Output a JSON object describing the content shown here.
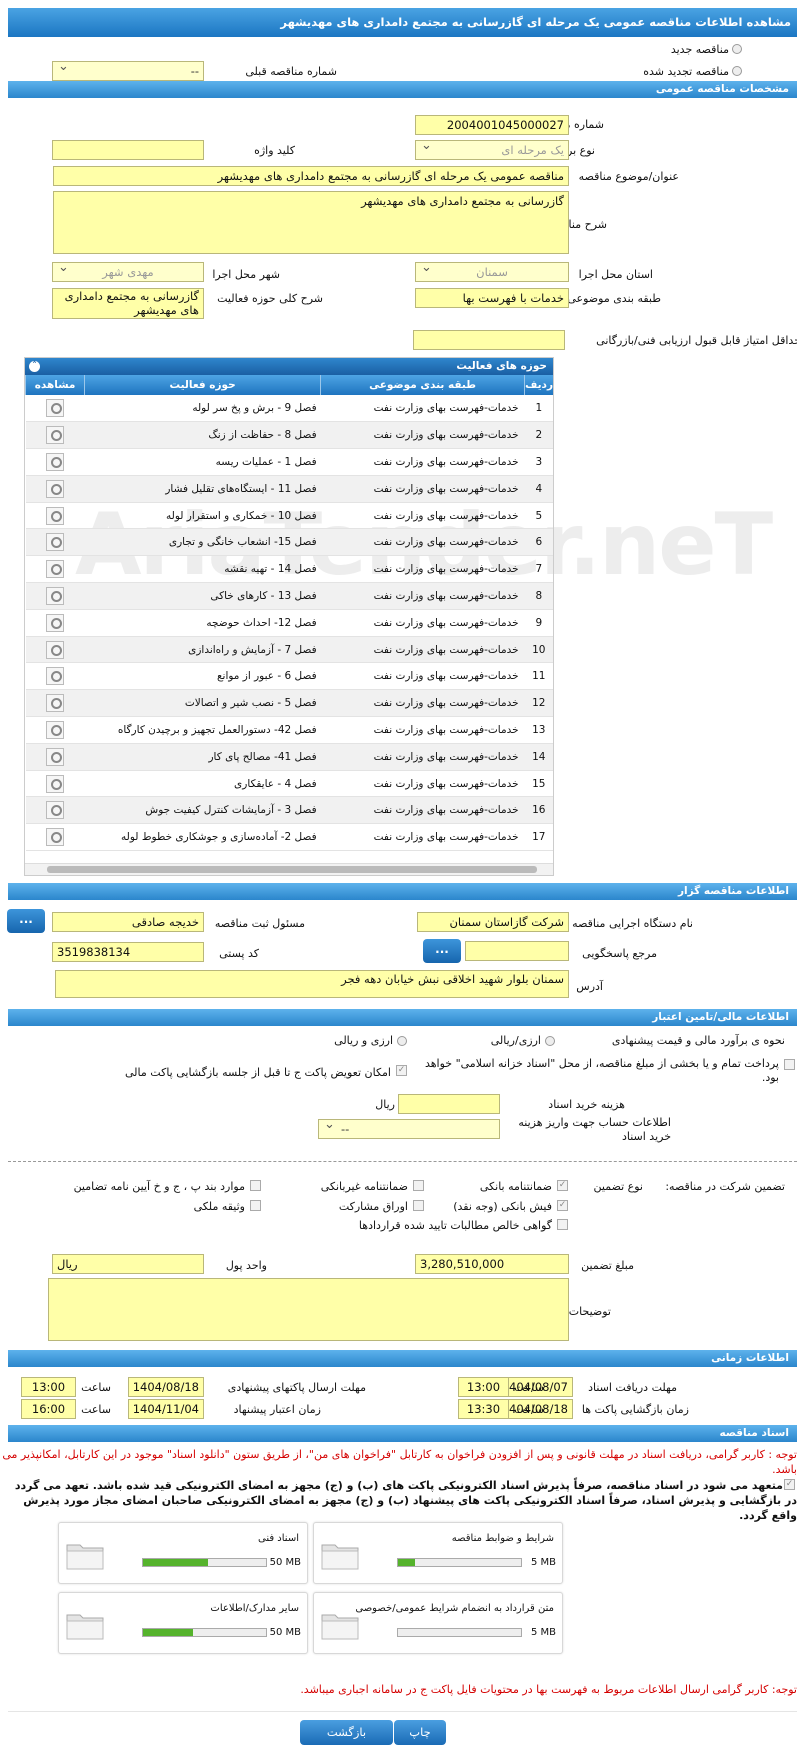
{
  "page_title": "مشاهده اطلاعات مناقصه عمومی یک مرحله ای گازرسانی به مجتمع دامداری های مهدیشهر",
  "tender_type": {
    "new": "مناقصه جدید",
    "renewed": "مناقصه تجدید شده",
    "prev_number_label": "شماره مناقصه قبلی",
    "prev_number_value": "--"
  },
  "general": {
    "header": "مشخصات مناقصه عمومی",
    "number_label": "شماره مناقصه",
    "number_value": "2004001045000027",
    "type_label": "نوع برگزاری",
    "type_value": "یک مرحله ای",
    "keyword_label": "کلید واژه",
    "keyword_value": "",
    "subject_label": "عنوان/موضوع مناقصه",
    "subject_value": "مناقصه عمومی یک مرحله ای گازرسانی به مجتمع دامداری های مهدیشهر",
    "desc_label": "شرح مناقصه",
    "desc_value": "گازرسانی به مجتمع دامداری های مهدیشهر",
    "province_label": "استان محل اجرا",
    "province_value": "سمنان",
    "city_label": "شهر محل اجرا",
    "city_value": "مهدی شهر",
    "category_label": "طبقه بندی موضوعی",
    "category_value": "خدمات با فهرست بها",
    "scope_label": "شرح کلی حوزه فعالیت",
    "scope_value": "گازرسانی به مجتمع دامداری های مهدیشهر",
    "min_score_label": "حداقل امتیاز قابل قبول ارزیابی فنی/بازرگانی",
    "min_score_value": ""
  },
  "activities": {
    "header": "حوزه های فعالیت",
    "col_row": "ردیف",
    "col_category": "طبقه بندی موضوعی",
    "col_area": "حوزه فعالیت",
    "col_view": "مشاهده",
    "rows": [
      {
        "n": "1",
        "cat": "خدمات-فهرست بهای وزارت نفت",
        "area": "فصل 9 - برش و پخ سر لوله"
      },
      {
        "n": "2",
        "cat": "خدمات-فهرست بهای وزارت نفت",
        "area": "فصل 8 - حفاظت از زنگ"
      },
      {
        "n": "3",
        "cat": "خدمات-فهرست بهای وزارت نفت",
        "area": "فصل 1 - عملیات ریسه"
      },
      {
        "n": "4",
        "cat": "خدمات-فهرست بهای وزارت نفت",
        "area": "فصل 11 - ایستگاه‌های تقلیل فشار"
      },
      {
        "n": "5",
        "cat": "خدمات-فهرست بهای وزارت نفت",
        "area": "فصل 10 - خمکاری و استقرار لوله"
      },
      {
        "n": "6",
        "cat": "خدمات-فهرست بهای وزارت نفت",
        "area": "فصل 15- انشعاب خانگی و تجاری"
      },
      {
        "n": "7",
        "cat": "خدمات-فهرست بهای وزارت نفت",
        "area": "فصل 14 - تهیه نقشه"
      },
      {
        "n": "8",
        "cat": "خدمات-فهرست بهای وزارت نفت",
        "area": "فصل 13 - کارهای خاکی"
      },
      {
        "n": "9",
        "cat": "خدمات-فهرست بهای وزارت نفت",
        "area": "فصل 12- احداث حوضچه"
      },
      {
        "n": "10",
        "cat": "خدمات-فهرست بهای وزارت نفت",
        "area": "فصل 7 - آزمایش و راه‌اندازی"
      },
      {
        "n": "11",
        "cat": "خدمات-فهرست بهای وزارت نفت",
        "area": "فصل 6 - عبور از موانع"
      },
      {
        "n": "12",
        "cat": "خدمات-فهرست بهای وزارت نفت",
        "area": "فصل 5 - نصب شیر و اتصالات"
      },
      {
        "n": "13",
        "cat": "خدمات-فهرست بهای وزارت نفت",
        "area": "فصل 42- دستورالعمل تجهیز و برچیدن کارگاه"
      },
      {
        "n": "14",
        "cat": "خدمات-فهرست بهای وزارت نفت",
        "area": "فصل 41- مصالح پای کار"
      },
      {
        "n": "15",
        "cat": "خدمات-فهرست بهای وزارت نفت",
        "area": "فصل 4 - عایقکاری"
      },
      {
        "n": "16",
        "cat": "خدمات-فهرست بهای وزارت نفت",
        "area": "فصل 3 - آزمایشات کنترل کیفیت جوش"
      },
      {
        "n": "17",
        "cat": "خدمات-فهرست بهای وزارت نفت",
        "area": "فصل 2- آماده‌سازی و جوشکاری خطوط لوله"
      }
    ]
  },
  "organizer": {
    "header": "اطلاعات مناقصه گزار",
    "org_label": "نام دستگاه اجرایی مناقصه گزار",
    "org_value": "شرکت گازاستان سمنان",
    "resp_label": "مسئول ثبت مناقصه",
    "resp_value": "خدیجه صادقی",
    "ref_label": "مرجع پاسخگویی",
    "ref_value": "",
    "postal_label": "کد پستی",
    "postal_value": "3519838134",
    "address_label": "آدرس",
    "address_value": "سمنان بلوار شهید اخلاقی نبش خیابان دهه فجر",
    "dots": "..."
  },
  "finance": {
    "header": "اطلاعات مالی/تامین اعتبار",
    "estimate_label": "نحوه ی برآورد مالی و قیمت پیشنهادی",
    "opt_currency": "ارزی/ریالی",
    "opt_currency2": "ارزی و ریالی",
    "treasury_text": "پرداخت تمام و یا بخشی از مبلغ مناقصه، از محل \"اسناد خزانه اسلامی\" خواهد بود.",
    "swap_text": "امکان تعویض پاکت ج تا قبل از جلسه بازگشایی پاکت مالی",
    "doc_fee_label": "هزینه خرید اسناد",
    "doc_fee_unit": "ریال",
    "account_label": "اطلاعات حساب جهت واریز هزینه خرید اسناد",
    "account_value": "--"
  },
  "guarantee": {
    "title": "تضمین شرکت در مناقصه:",
    "type_label": "نوع تضمین",
    "items": [
      "ضمانتنامه بانکی",
      "ضمانتنامه غیربانکی",
      "موارد بند پ ، ج و خ آیین نامه تضامین",
      "فیش بانکی (وجه نقد)",
      "اوراق مشارکت",
      "وثیقه ملکی",
      "گواهی خالص مطالبات تایید شده قراردادها"
    ],
    "amount_label": "مبلغ تضمین",
    "amount_value": "3,280,510,000",
    "unit_label": "واحد پول",
    "unit_value": "ریال",
    "notes_label": "توضیحات"
  },
  "timing": {
    "header": "اطلاعات زمانی",
    "doc_deadline_label": "مهلت دریافت اسناد",
    "doc_deadline_date": "1404/08/07",
    "doc_deadline_time": "13:00",
    "send_label": "مهلت ارسال پاکتهای پیشنهادی",
    "send_date": "1404/08/18",
    "send_time": "13:00",
    "open_label": "زمان بازگشایی پاکت ها",
    "open_date": "1404/08/18",
    "open_time": "13:30",
    "valid_label": "زمان اعتبار پیشنهاد",
    "valid_date": "1404/11/04",
    "valid_time": "16:00",
    "time_word": "ساعت"
  },
  "docs": {
    "header": "اسناد مناقصه",
    "note1": "توجه : کاربر گرامی، دریافت اسناد در مهلت قانونی و پس از افزودن فراخوان به کارتابل \"فراخوان های من\"، از طریق ستون \"دانلود اسناد\" موجود در این کارتابل، امکانپذیر می باشد.",
    "commit": "متعهد می شود در اسناد مناقصه، صرفاً پذیرش اسناد الکترونیکی پاکت های (ب) و (ج) مجهز به امضای الکترونیکی قید شده باشد. تعهد می گردد در بازگشایی و پذیرش اسناد، صرفاً اسناد الکترونیکی پاکت های پیشنهاد (ب) و (ج) مجهز به امضای الکترونیکی صاحبان امضای مجاز مورد پذیرش واقع گردد.",
    "cards": [
      {
        "title": "شرایط و ضوابط مناقصه",
        "size": "717 KB",
        "max": "5 MB",
        "fill": 0.14
      },
      {
        "title": "اسناد فنی",
        "size": "26.35 MB",
        "max": "50 MB",
        "fill": 0.53
      },
      {
        "title": "متن قرارداد به انضمام شرایط عمومی/خصوصی",
        "size": "0 MB",
        "max": "5 MB",
        "fill": 0
      },
      {
        "title": "سایر مدارک/اطلاعات",
        "size": "20.5 MB",
        "max": "50 MB",
        "fill": 0.41
      }
    ],
    "note2": "توجه: کاربر گرامی ارسال اطلاعات مربوط به فهرست بها در محتویات فایل پاکت ج در سامانه اجباری میباشد."
  },
  "buttons": {
    "print": "چاپ",
    "back": "بازگشت"
  },
  "watermark": "AriaTender.neT"
}
